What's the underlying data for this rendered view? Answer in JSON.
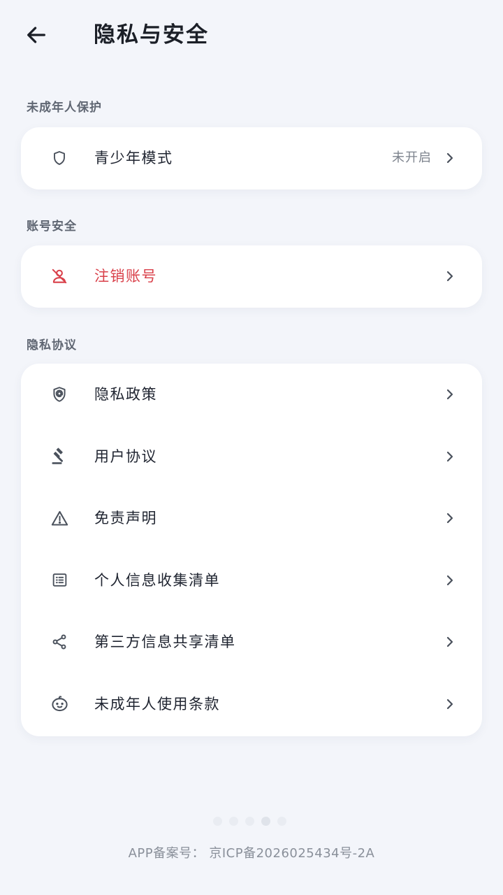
{
  "header": {
    "title": "隐私与安全",
    "back_icon": "arrow-left-icon"
  },
  "sections": {
    "minor": {
      "label": "未成年人保护",
      "items": [
        {
          "label": "青少年模式",
          "status": "未开启",
          "icon": "shield-icon"
        }
      ]
    },
    "account": {
      "label": "账号安全",
      "items": [
        {
          "label": "注销账号",
          "icon": "user-off-icon",
          "color": "#d9404a"
        }
      ]
    },
    "privacy": {
      "label": "隐私协议",
      "items": [
        {
          "label": "隐私政策",
          "icon": "shield-user-icon"
        },
        {
          "label": "用户协议",
          "icon": "gavel-icon"
        },
        {
          "label": "免责声明",
          "icon": "warning-icon"
        },
        {
          "label": "个人信息收集清单",
          "icon": "list-icon"
        },
        {
          "label": "第三方信息共享清单",
          "icon": "share-icon"
        },
        {
          "label": "未成年人使用条款",
          "icon": "child-icon"
        }
      ]
    }
  },
  "footer": {
    "icp": "APP备案号：  京ICP备2026025434号-2A"
  },
  "colors": {
    "background": "#f3f5fa",
    "card": "#ffffff",
    "danger": "#d9404a",
    "icon": "#4a515c"
  }
}
